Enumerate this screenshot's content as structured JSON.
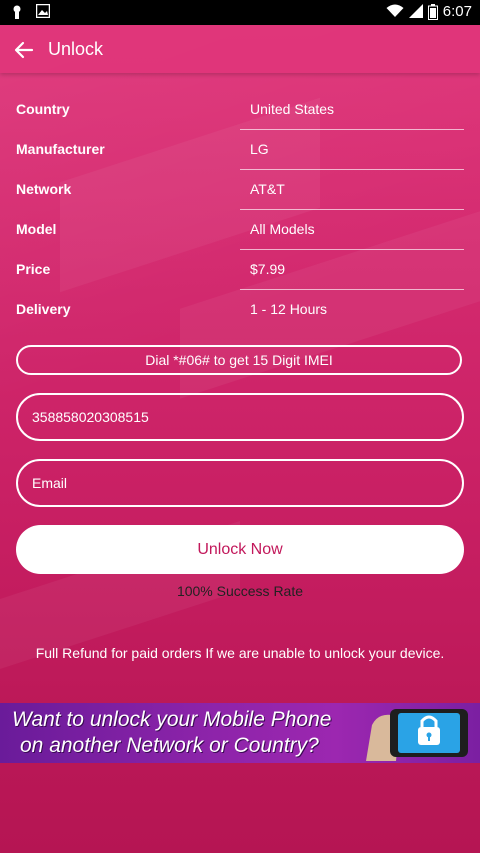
{
  "status_bar": {
    "time": "6:07"
  },
  "app_bar": {
    "title": "Unlock"
  },
  "details": [
    {
      "label": "Country",
      "value": "United States"
    },
    {
      "label": "Manufacturer",
      "value": "LG"
    },
    {
      "label": "Network",
      "value": "AT&T"
    },
    {
      "label": "Model",
      "value": "All Models"
    },
    {
      "label": "Price",
      "value": "$7.99"
    },
    {
      "label": "Delivery",
      "value": "1 - 12 Hours"
    }
  ],
  "imei_hint": "Dial *#06# to get 15 Digit IMEI",
  "imei_field": {
    "value": "358858020308515"
  },
  "email_field": {
    "placeholder": "Email"
  },
  "unlock_button": "Unlock Now",
  "success_rate": "100% Success Rate",
  "refund_note": "Full Refund for paid orders If we are unable to unlock your device.",
  "banner": {
    "line1": "Want to unlock your Mobile Phone",
    "line2": "on another Network or Country?"
  },
  "colors": {
    "accent": "#c2185b",
    "app_bar": "#e0357a",
    "banner": "#8e24aa"
  }
}
